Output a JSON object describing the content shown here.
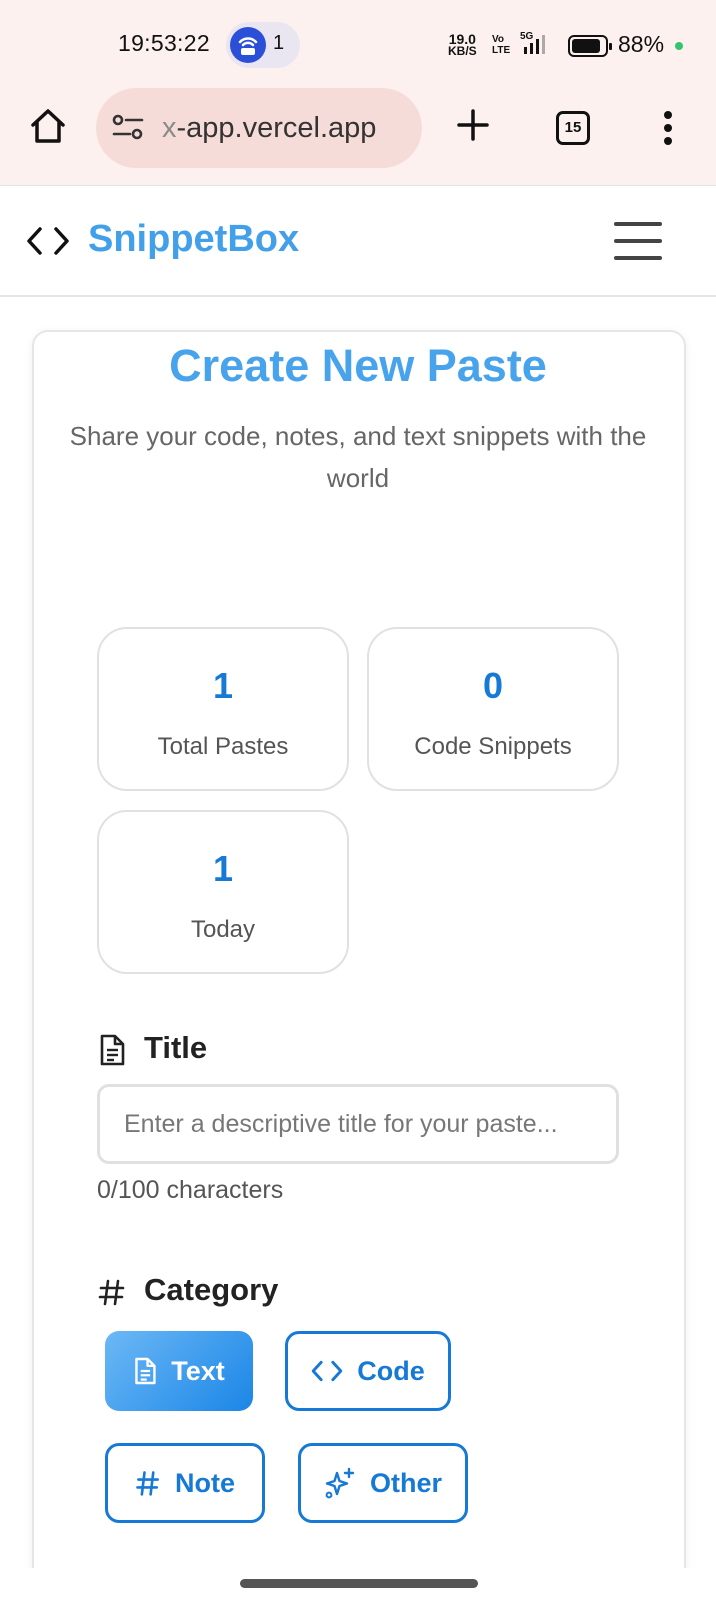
{
  "status_bar": {
    "time": "19:53:22",
    "hotspot_count": "1",
    "net_speed_value": "19.0",
    "net_speed_unit": "KB/S",
    "volte_top": "Vo",
    "volte_bottom": "LTE",
    "network_type": "5G",
    "battery_percent": "88%"
  },
  "browser": {
    "url_prefix": "x",
    "url_rest": "-app.vercel.app",
    "tab_count": "15",
    "icons": [
      "home-icon",
      "site-settings-icon",
      "plus-icon",
      "tabs-icon",
      "more-vert-icon"
    ]
  },
  "app": {
    "brand": "SnippetBox",
    "brand_icon": "code-icon",
    "menu_icon": "hamburger-icon",
    "accent_color": "#1679d6",
    "title_color": "#47a3ec"
  },
  "form": {
    "heading": "Create New Paste",
    "subheading": "Share your code, notes, and text snippets with the world",
    "stats": [
      {
        "value": "1",
        "label": "Total Pastes"
      },
      {
        "value": "0",
        "label": "Code Snippets"
      },
      {
        "value": "1",
        "label": "Today"
      }
    ],
    "title_label": "Title",
    "title_placeholder": "Enter a descriptive title for your paste...",
    "title_value": "",
    "char_count": "0/100 characters",
    "category_label": "Category",
    "categories": [
      {
        "label": "Text",
        "icon": "document-icon",
        "selected": true
      },
      {
        "label": "Code",
        "icon": "code-icon",
        "selected": false
      },
      {
        "label": "Note",
        "icon": "hash-icon",
        "selected": false
      },
      {
        "label": "Other",
        "icon": "sparkles-icon",
        "selected": false
      }
    ]
  }
}
